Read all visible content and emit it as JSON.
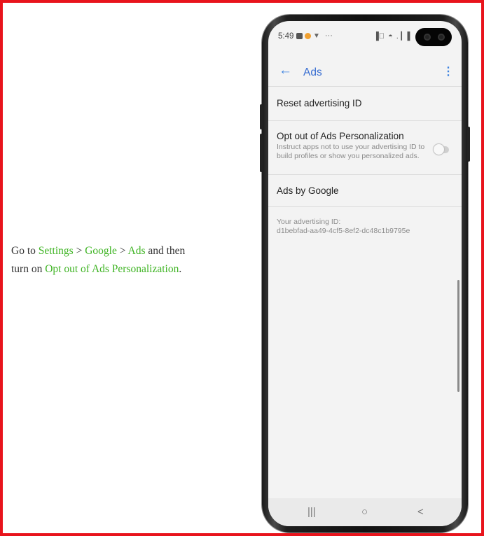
{
  "instruction": {
    "go_to": "Go to",
    "settings": "Settings",
    "sep1": ">",
    "google": "Google",
    "sep2": ">",
    "ads": "Ads",
    "and_then": "and then",
    "turn_on": "turn on",
    "opt_out": "Opt out of Ads Personalization",
    "period": "."
  },
  "colors": {
    "frame_border": "#e8141c",
    "highlight": "#3fb424",
    "accent": "#3c82e0"
  },
  "phone": {
    "status": {
      "time": "5:49",
      "overflow": "···",
      "right_icons": "▐⃤ ◓ .┃ ▌"
    },
    "appbar": {
      "back_icon": "arrow-left-icon",
      "title": "Ads",
      "menu_icon": "more-vert-icon"
    },
    "reset_id": {
      "title": "Reset advertising ID"
    },
    "opt_out": {
      "title": "Opt out of Ads Personalization",
      "description": "Instruct apps not to use your advertising ID to build profiles or show you personalized ads.",
      "enabled": false
    },
    "ads_by_google": {
      "title": "Ads by Google"
    },
    "advertising_id": {
      "label": "Your advertising ID:",
      "value": "d1bebfad-aa49-4cf5-8ef2-dc48c1b9795e"
    },
    "navbar": {
      "recents_glyph": "|||",
      "home_glyph": "○",
      "back_glyph": "<"
    }
  }
}
